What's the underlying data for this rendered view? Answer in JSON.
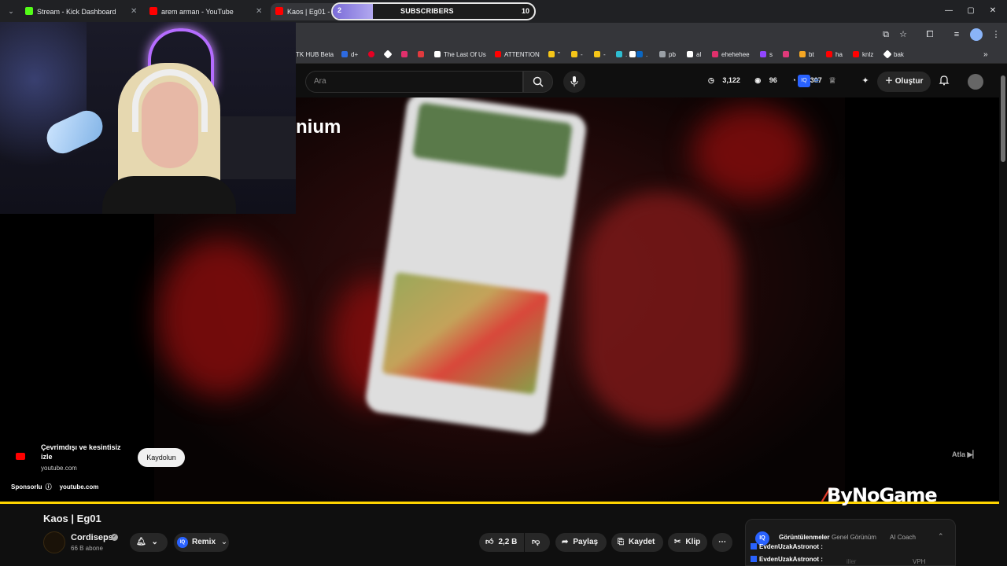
{
  "browser": {
    "tabs": [
      {
        "title": "Stream - Kick Dashboard",
        "favicon_color": "#53fc18"
      },
      {
        "title": "arem arman - YouTube",
        "favicon_color": "#ff0000"
      },
      {
        "title": "Kaos | Eg01 - Yo",
        "favicon_color": "#ff0000"
      }
    ],
    "bookmarks": [
      {
        "label": "TK HUB Beta",
        "color": ""
      },
      {
        "label": "d+",
        "color": "#2d6ae0"
      },
      {
        "label": "",
        "color": "#ffffff"
      },
      {
        "label": "",
        "color": "#e60023"
      },
      {
        "label": "",
        "color": "#e1306c"
      },
      {
        "label": "",
        "color": "#e03a3e"
      },
      {
        "label": "The Last Of Us",
        "color": "#ffffff"
      },
      {
        "label": "ATTENTION",
        "color": "#ff0000"
      },
      {
        "label": "\"",
        "color": "#f5c518"
      },
      {
        "label": "-",
        "color": "#f5c518"
      },
      {
        "label": "-",
        "color": "#f5c518"
      },
      {
        "label": ".",
        "color": "#2ebdd1"
      },
      {
        "label": "-",
        "color": "#ffffff"
      },
      {
        "label": ".",
        "color": "#0a66c2"
      },
      {
        "label": "pb",
        "color": "#9aa0a6"
      },
      {
        "label": "al",
        "color": "#ffffff"
      },
      {
        "label": "ehehehee",
        "color": "#e1306c"
      },
      {
        "label": "s",
        "color": "#9146ff"
      },
      {
        "label": "",
        "color": "#e03a7a"
      },
      {
        "label": "bt",
        "color": "#f5a623"
      },
      {
        "label": "ha",
        "color": "#ff0000"
      },
      {
        "label": "knlz",
        "color": "#ff0000"
      },
      {
        "label": "bak",
        "color": "#ffffff"
      }
    ]
  },
  "subs_goal": {
    "current": "2",
    "label": "SUBSCRIBERS",
    "goal": "10",
    "progress": 0.2,
    "accent": "#9b8cf0"
  },
  "masthead": {
    "search_placeholder": "Ara",
    "stats": {
      "views": "3,122",
      "watching": "96",
      "likes": "4,307"
    },
    "create_label": "Oluştur"
  },
  "video": {
    "overlay_text": "nium",
    "ad": {
      "title": "Çevrimdışı ve kesintisiz izle",
      "domain": "youtube.com",
      "button": "Kaydolun",
      "sponsor_label": "Sponsorlu",
      "sponsor_domain": "youtube.com",
      "skip_label": "Atla"
    },
    "progress": 1.0,
    "progress_color": "#ffd400",
    "watermark": "ByNoGame"
  },
  "details": {
    "title": "Kaos | Eg01",
    "channel": "Cordiseps",
    "subscribers": "66 B abone",
    "remix_label": "Remix",
    "likes": "2,2 B",
    "share_label": "Paylaş",
    "save_label": "Kaydet",
    "clip_label": "Klip"
  },
  "panel": {
    "iq_label": "IQ",
    "tabs": [
      "Görüntülenmeler",
      "Genel Görünüm",
      "AI Coach"
    ],
    "rows": [
      "EvdenUzakAstronot :",
      "EvdenUzakAstronot :"
    ],
    "vph_label": "VPH",
    "faint_label": "iller"
  }
}
